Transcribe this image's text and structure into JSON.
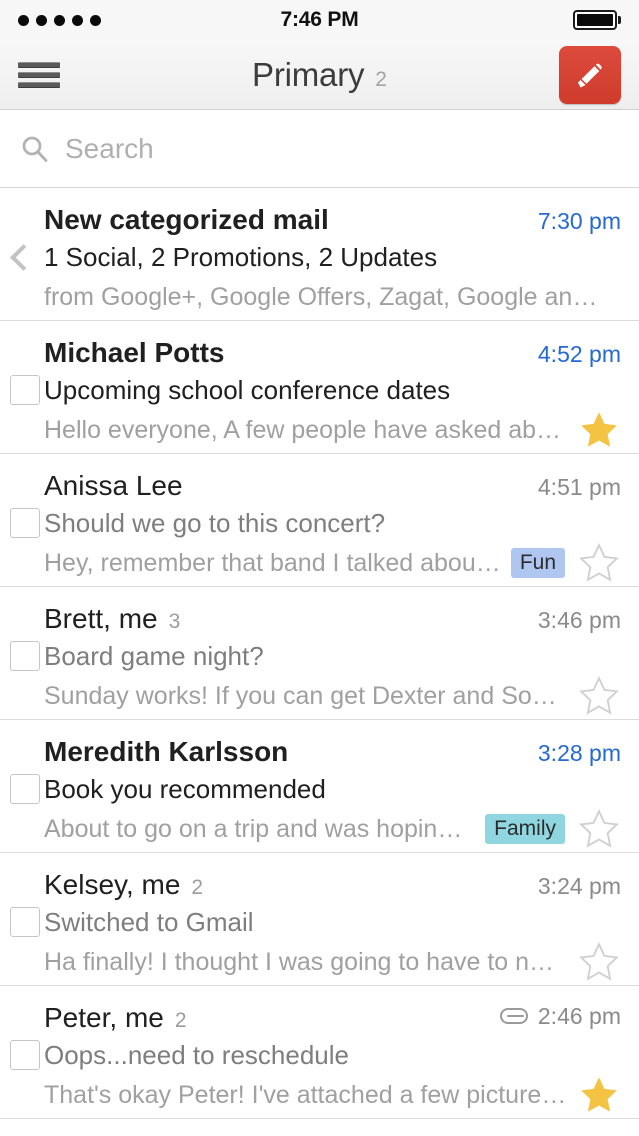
{
  "status_bar": {
    "signal_dots": 5,
    "time": "7:46 PM",
    "battery_icon": "battery-full-icon"
  },
  "nav": {
    "menu_icon": "hamburger-menu-icon",
    "title": "Primary",
    "unread_count": "2",
    "compose_icon": "compose-pencil-icon",
    "compose_color": "#d6402f"
  },
  "search": {
    "icon": "search-icon",
    "placeholder": "Search",
    "value": ""
  },
  "colors": {
    "unread_time": "#2569d4",
    "read_time": "#8a8a8a",
    "star_filled": "#f5c343",
    "star_empty": "#d0d0d0",
    "label_fun_bg": "#aec6f0",
    "label_family_bg": "#8fd6e0"
  },
  "emails": [
    {
      "type": "promo",
      "leading_icon": "chevron-left-icon",
      "sender": "New categorized mail",
      "thread_count": "",
      "unread": true,
      "time": "7:30 pm",
      "subject": "1 Social, 2 Promotions, 2 Updates",
      "snippet": "from Google+, Google Offers, Zagat, Google and G…",
      "label": "",
      "label_bg": "",
      "starred": null,
      "has_attachment": false
    },
    {
      "type": "mail",
      "leading_icon": "checkbox",
      "sender": "Michael Potts",
      "thread_count": "",
      "unread": true,
      "time": "4:52 pm",
      "subject": "Upcoming school conference dates",
      "snippet": "Hello everyone, A few people have asked about the …",
      "label": "",
      "label_bg": "",
      "starred": true,
      "has_attachment": false
    },
    {
      "type": "mail",
      "leading_icon": "checkbox",
      "sender": "Anissa Lee",
      "thread_count": "",
      "unread": false,
      "time": "4:51 pm",
      "subject": "Should we go to this concert?",
      "snippet": "Hey, remember that band I talked about? Well …",
      "label": "Fun",
      "label_bg": "#aec6f0",
      "starred": false,
      "has_attachment": false
    },
    {
      "type": "mail",
      "leading_icon": "checkbox",
      "sender": "Brett, me",
      "thread_count": "3",
      "unread": false,
      "time": "3:46 pm",
      "subject": "Board game night?",
      "snippet": "Sunday works! If you can get Dexter and Sophie I wi…",
      "label": "",
      "label_bg": "",
      "starred": false,
      "has_attachment": false
    },
    {
      "type": "mail",
      "leading_icon": "checkbox",
      "sender": "Meredith Karlsson",
      "thread_count": "",
      "unread": true,
      "time": "3:28 pm",
      "subject": "Book you recommended",
      "snippet": "About to go on a trip and was hoping to star…",
      "label": "Family",
      "label_bg": "#8fd6e0",
      "starred": false,
      "has_attachment": false
    },
    {
      "type": "mail",
      "leading_icon": "checkbox",
      "sender": "Kelsey, me",
      "thread_count": "2",
      "unread": false,
      "time": "3:24 pm",
      "subject": "Switched to Gmail",
      "snippet": "Ha finally! I thought I was going to have to nag you f…",
      "label": "",
      "label_bg": "",
      "starred": false,
      "has_attachment": false
    },
    {
      "type": "mail",
      "leading_icon": "checkbox",
      "sender": "Peter, me",
      "thread_count": "2",
      "unread": false,
      "time": "2:46 pm",
      "subject": "Oops...need to reschedule",
      "snippet": "That's okay Peter! I've attached a few pictures of m…",
      "label": "",
      "label_bg": "",
      "starred": true,
      "has_attachment": true
    }
  ]
}
